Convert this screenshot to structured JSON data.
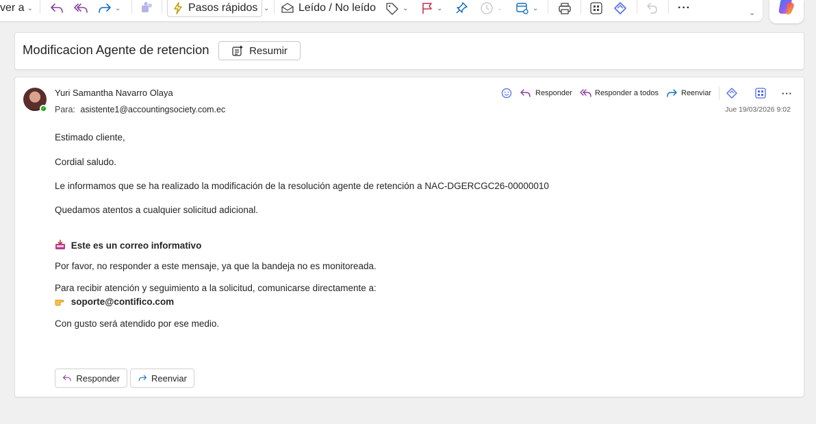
{
  "toolbar": {
    "view_label": "ver a",
    "quick_steps_label": "Pasos rápidos",
    "read_unread_label": "Leído / No leído"
  },
  "subject": {
    "title": "Modificacion Agente de retencion",
    "summarize_label": "Resumir"
  },
  "message": {
    "sender": "Yuri Samantha Navarro Olaya",
    "to_label": "Para:",
    "to_address": "asistente1@accountingsociety.com.ec",
    "date": "Jue 19/03/2026 9:02",
    "actions": {
      "reply": "Responder",
      "reply_all": "Responder a todos",
      "forward": "Reenviar"
    },
    "body": {
      "greeting": "Estimado cliente,",
      "salutation": "Cordial saludo.",
      "info": "Le informamos que se ha realizado la modificación de la resolución agente de retención a NAC-DGERCGC26-00000010",
      "attentive": "Quedamos atentos a cualquier solicitud adicional.",
      "informative_heading": "Este es un correo informativo",
      "no_reply": "Por favor, no responder a este mensaje, ya que la bandeja no es monitoreada.",
      "contact_intro": "Para recibir atención y seguimiento a la solicitud, comunicarse directamente a:",
      "contact_email": "soporte@contifico.com",
      "closing": "Con gusto será atendido por ese medio."
    },
    "bottom_buttons": {
      "reply": "Responder",
      "forward": "Reenviar"
    }
  },
  "icons": {
    "inbox_emoji": "📩",
    "pointing_emoji": "👉"
  },
  "colors": {
    "accent_purple": "#8a3f9e",
    "accent_blue": "#0f6cbd",
    "presence_green": "#13a10e",
    "flag_red": "#c4314b"
  }
}
